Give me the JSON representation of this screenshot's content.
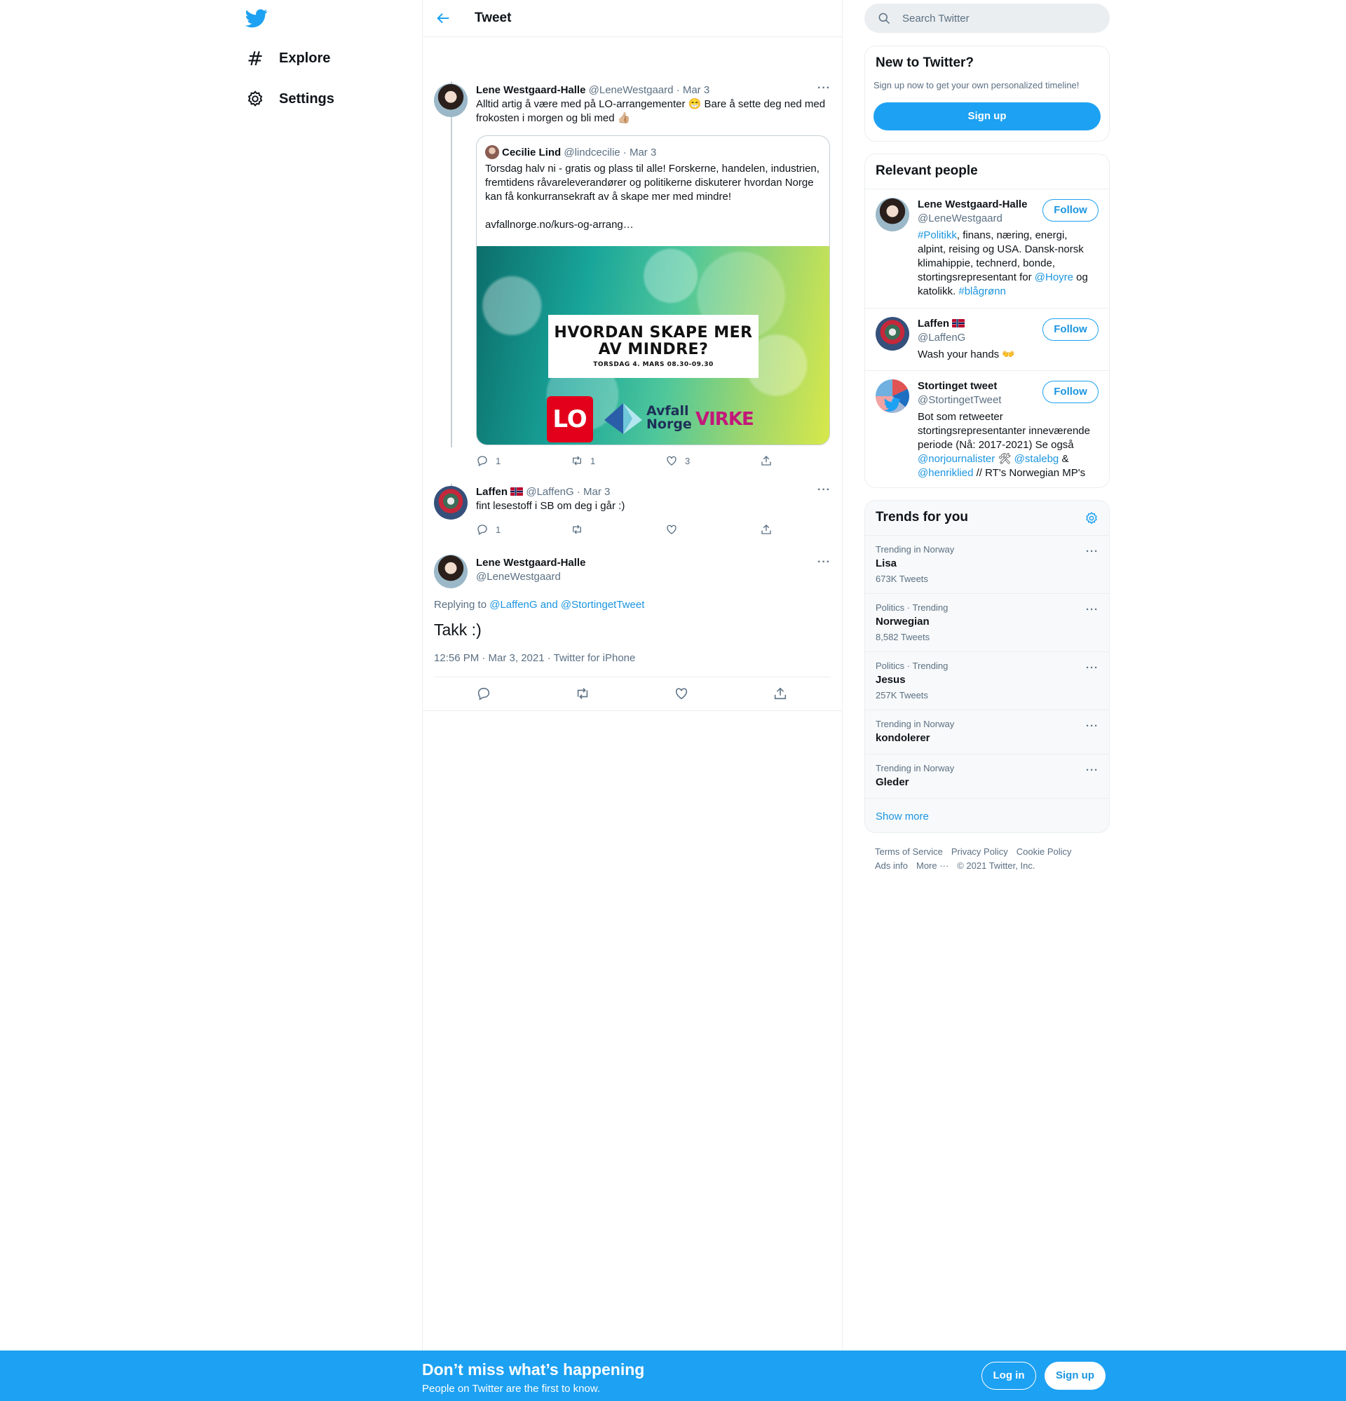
{
  "nav": {
    "explore": "Explore",
    "settings": "Settings"
  },
  "header": {
    "title": "Tweet"
  },
  "tweet1": {
    "name": "Lene Westgaard-Halle",
    "handle": "@LeneWestgaard",
    "date": "· Mar 3",
    "text_line1": "Alltid artig å være med på LO-arrangementer 😁 Bare å sette deg ned med",
    "text_line2": "frokosten i morgen og bli med 👍🏼",
    "quote": {
      "name": "Cecilie Lind",
      "handle": "@lindcecilie",
      "date": "· Mar 3",
      "text": "Torsdag halv ni - gratis og plass til alle! Forskerne, handelen, industrien, fremtidens råvareleverandører og politikerne diskuterer hvordan Norge kan få konkurransekraft av å skape mer med mindre!",
      "link": "avfallnorge.no/kurs-og-arrang…",
      "poster_title": "HVORDAN SKAPE MER AV MINDRE?",
      "poster_sub": "TORSDAG 4. MARS 08.30-09.30",
      "logo_lo": "LO",
      "logo_avfall": "Avfall Norge",
      "logo_virke": "VIRKE"
    },
    "replies": "1",
    "retweets": "1",
    "likes": "3"
  },
  "tweet2": {
    "name": "Laffen",
    "handle": "@LaffenG",
    "date": "· Mar 3",
    "text": "fint lesestoff i SB om deg i går :)",
    "replies": "1"
  },
  "focus": {
    "name": "Lene Westgaard-Halle",
    "handle": "@LeneWestgaard",
    "replying_prefix": "Replying to",
    "replying_to": "@LaffenG and @StortingetTweet",
    "text": "Takk :)",
    "meta": "12:56 PM · Mar 3, 2021 · Twitter for iPhone"
  },
  "search": {
    "placeholder": "Search Twitter"
  },
  "new_card": {
    "title": "New to Twitter?",
    "subtitle": "Sign up now to get your own personalized timeline!",
    "button": "Sign up"
  },
  "people": {
    "title": "Relevant people",
    "follow": "Follow",
    "items": [
      {
        "name": "Lene Westgaard-Halle",
        "handle": "@LeneWestgaard",
        "bio_tag1": "#Politikk",
        "bio_text1": ", finans, næring, energi, alpint, reising og USA. Dansk-norsk klimahippie, technerd, bonde, stortingsrepresentant for ",
        "bio_mention": "@Hoyre",
        "bio_text2": " og katolikk. ",
        "bio_tag2": "#blågrønn"
      },
      {
        "name": "Laffen",
        "handle": "@LaffenG",
        "bio": "Wash your hands 👐"
      },
      {
        "name": "Stortinget tweet",
        "handle": "@StortingetTweet",
        "bio_text1": "Bot som retweeter stortingsrepresentanter inneværende periode (Nå: 2017-2021) Se også ",
        "bio_m1": "@norjournalister",
        "bio_text2": " 🛠 ",
        "bio_m2": "@stalebg",
        "bio_text3": " & ",
        "bio_m3": "@henriklied",
        "bio_text4": " // RT's Norwegian MP's"
      }
    ]
  },
  "trends": {
    "title": "Trends for you",
    "show_more": "Show more",
    "items": [
      {
        "context": "Trending in Norway",
        "name": "Lisa",
        "count": "673K Tweets"
      },
      {
        "context": "Politics · Trending",
        "name": "Norwegian",
        "count": "8,582 Tweets"
      },
      {
        "context": "Politics · Trending",
        "name": "Jesus",
        "count": "257K Tweets"
      },
      {
        "context": "Trending in Norway",
        "name": "kondolerer"
      },
      {
        "context": "Trending in Norway",
        "name": "Gleder"
      }
    ]
  },
  "footer": {
    "terms": "Terms of Service",
    "privacy": "Privacy Policy",
    "cookie": "Cookie Policy",
    "ads": "Ads info",
    "more": "More ···",
    "copyright": "© 2021 Twitter, Inc."
  },
  "bottombar": {
    "title": "Don’t miss what’s happening",
    "subtitle": "People on Twitter are the first to know.",
    "login": "Log in",
    "signup": "Sign up"
  }
}
